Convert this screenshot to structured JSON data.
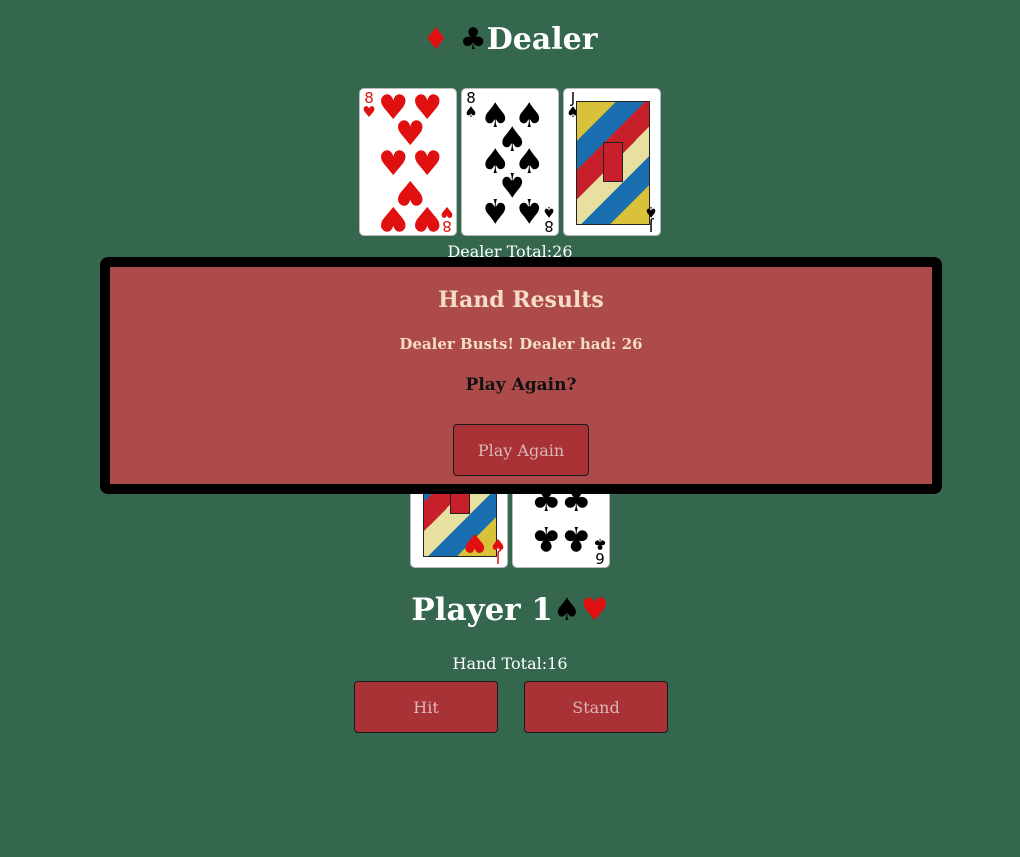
{
  "dealer": {
    "title": "Dealer",
    "title_suits": [
      "♦",
      "♣"
    ],
    "total_label": "Dealer Total:",
    "total": "26",
    "cards": [
      {
        "rank": "8",
        "suit": "♥",
        "color": "#e01010"
      },
      {
        "rank": "8",
        "suit": "♠",
        "color": "#000000"
      },
      {
        "rank": "J",
        "suit": "♠",
        "color": "#000000"
      }
    ]
  },
  "player": {
    "title": "Player 1",
    "title_suits": [
      "♠",
      "♥"
    ],
    "total_label": "Hand Total:",
    "total": "16",
    "cards": [
      {
        "rank": "J",
        "suit": "♥",
        "color": "#e01010"
      },
      {
        "rank": "6",
        "suit": "♣",
        "color": "#000000"
      }
    ],
    "hit_label": "Hit",
    "stand_label": "Stand"
  },
  "modal": {
    "title": "Hand Results",
    "message": "Dealer Busts! Dealer had: 26",
    "question": "Play Again?",
    "button_label": "Play Again"
  },
  "colors": {
    "table_green": "#35674e",
    "button_red": "#a83236",
    "modal_red": "#ad4a4a",
    "suit_red": "#e01010"
  }
}
